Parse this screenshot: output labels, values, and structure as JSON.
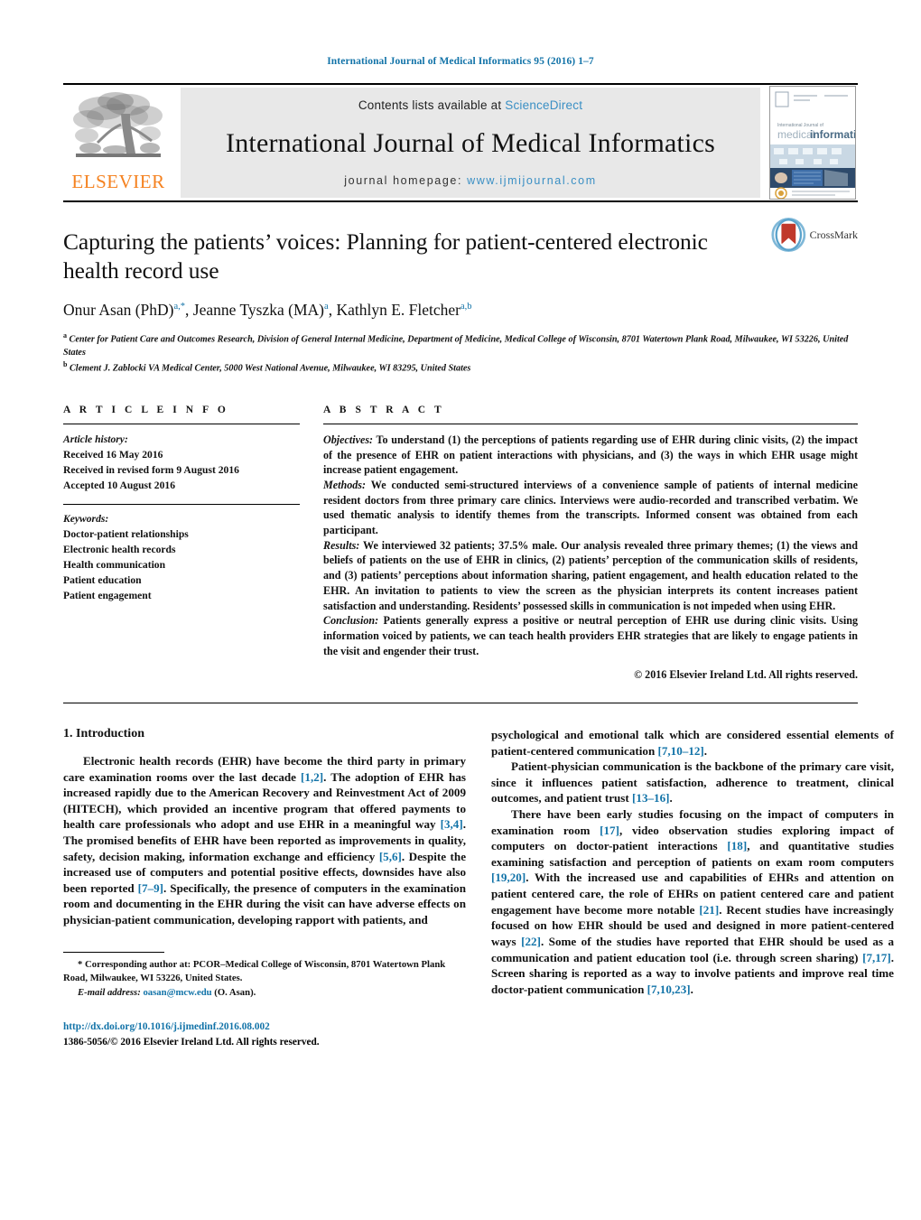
{
  "running_head": "International Journal of Medical Informatics 95 (2016) 1–7",
  "masthead": {
    "publisher_name": "ELSEVIER",
    "contents_prefix": "Contents lists available at",
    "sciencedirect": "ScienceDirect",
    "journal_title": "International Journal of Medical Informatics",
    "homepage_prefix": "journal homepage:",
    "homepage_url": "www.ijmijournal.com",
    "cover_title_1": "medical",
    "cover_title_2": "informatics",
    "link_color": "#3a8fc4",
    "elsevier_orange": "#f58220"
  },
  "article": {
    "title": "Capturing the patients’ voices: Planning for patient-centered electronic health record use",
    "crossmark_label": "CrossMark",
    "authors_html": "Onur Asan (PhD)<sup>a,</sup><sup>*</sup>, Jeanne Tyszka (MA)<sup>a</sup>, Kathlyn E. Fletcher<sup>a,b</sup>",
    "affiliation_a": "Center for Patient Care and Outcomes Research, Division of General Internal Medicine, Department of Medicine, Medical College of Wisconsin, 8701 Watertown Plank Road, Milwaukee, WI 53226, United States",
    "affiliation_b": "Clement J. Zablocki VA Medical Center, 5000 West National Avenue, Milwaukee, WI 83295, United States",
    "affiliation_a_marker": "a",
    "affiliation_b_marker": "b"
  },
  "article_info": {
    "heading": "A R T I C L E   I N F O",
    "history_label": "Article history:",
    "history": [
      "Received 16 May 2016",
      "Received in revised form 9 August 2016",
      "Accepted 10 August 2016"
    ],
    "keywords_label": "Keywords:",
    "keywords": [
      "Doctor-patient relationships",
      "Electronic health records",
      "Health communication",
      "Patient education",
      "Patient engagement"
    ]
  },
  "abstract": {
    "heading": "A B S T R A C T",
    "objectives_label": "Objectives:",
    "objectives_text": " To understand (1) the perceptions of patients regarding use of EHR during clinic visits, (2) the impact of the presence of EHR on patient interactions with physicians, and (3) the ways in which EHR usage might increase patient engagement.",
    "methods_label": "Methods:",
    "methods_text": " We conducted semi-structured interviews of a convenience sample of patients of internal medicine resident doctors from three primary care clinics. Interviews were audio-recorded and transcribed verbatim. We used thematic analysis to identify themes from the transcripts. Informed consent was obtained from each participant.",
    "results_label": "Results:",
    "results_text": " We interviewed 32 patients; 37.5% male. Our analysis revealed three primary themes; (1) the views and beliefs of patients on the use of EHR in clinics, (2) patients’ perception of the communication skills of residents, and (3) patients’ perceptions about information sharing, patient engagement, and health education related to the EHR. An invitation to patients to view the screen as the physician interprets its content increases patient satisfaction and understanding. Residents’ possessed skills in communication is not impeded when using EHR.",
    "conclusion_label": "Conclusion:",
    "conclusion_text": " Patients generally express a positive or neutral perception of EHR use during clinic visits. Using information voiced by patients, we can teach health providers EHR strategies that are likely to engage patients in the visit and engender their trust.",
    "copyright": "© 2016 Elsevier Ireland Ltd. All rights reserved."
  },
  "introduction": {
    "heading": "1. Introduction",
    "left_paragraph_1_parts": [
      {
        "t": "Electronic health records (EHR) have become the third party in primary care examination rooms over the last decade "
      },
      {
        "t": "[1,2]",
        "ref": true
      },
      {
        "t": ". The adoption of EHR has increased rapidly due to the American Recovery and Reinvestment Act of 2009 (HITECH), which provided an incentive program that offered payments to health care professionals who adopt and use EHR in a meaningful way "
      },
      {
        "t": "[3,4]",
        "ref": true
      },
      {
        "t": ". The promised benefits of EHR have been reported as improvements in quality, safety, decision making, information exchange and efficiency "
      },
      {
        "t": "[5,6]",
        "ref": true
      },
      {
        "t": ". Despite the increased use of computers and potential positive effects, downsides have also been reported "
      },
      {
        "t": "[7–9]",
        "ref": true
      },
      {
        "t": ". Specifically, the presence of computers in the examination room and documenting in the EHR during the visit can have adverse effects on physician-patient communication, developing rapport with patients, and"
      }
    ],
    "right_paragraph_1_parts": [
      {
        "t": "psychological and emotional talk which are considered essential elements of patient-centered communication "
      },
      {
        "t": "[7,10–12]",
        "ref": true
      },
      {
        "t": "."
      }
    ],
    "right_paragraph_2_parts": [
      {
        "t": "Patient-physician communication is the backbone of the primary care visit, since it influences patient satisfaction, adherence to treatment, clinical outcomes, and patient trust "
      },
      {
        "t": "[13–16]",
        "ref": true
      },
      {
        "t": "."
      }
    ],
    "right_paragraph_3_parts": [
      {
        "t": "There have been early studies focusing on the impact of computers in examination room "
      },
      {
        "t": "[17]",
        "ref": true
      },
      {
        "t": ", video observation studies exploring impact of computers on doctor-patient interactions "
      },
      {
        "t": "[18]",
        "ref": true
      },
      {
        "t": ", and quantitative studies examining satisfaction and perception of patients on exam room computers "
      },
      {
        "t": "[19,20]",
        "ref": true
      },
      {
        "t": ". With the increased use and capabilities of EHRs and attention on patient centered care, the role of EHRs on patient centered care and patient engagement have become more notable "
      },
      {
        "t": "[21]",
        "ref": true
      },
      {
        "t": ". Recent studies have increasingly focused on how EHR should be used and designed in more patient-centered ways "
      },
      {
        "t": "[22]",
        "ref": true
      },
      {
        "t": ". Some of the studies have reported that EHR should be used as a communication and patient education tool (i.e. through screen sharing) "
      },
      {
        "t": "[7,17]",
        "ref": true
      },
      {
        "t": ". Screen sharing is reported as a way to involve patients and improve real time doctor-patient communication "
      },
      {
        "t": "[7,10,23]",
        "ref": true
      },
      {
        "t": "."
      }
    ]
  },
  "footer": {
    "corresponding_marker": "*",
    "corresponding_text": " Corresponding author at: PCOR–Medical College of Wisconsin, 8701 Watertown Plank Road, Milwaukee, WI 53226, United States.",
    "email_label": "E-mail address:",
    "email": "oasan@mcw.edu",
    "email_suffix": " (O. Asan).",
    "doi": "http://dx.doi.org/10.1016/j.ijmedinf.2016.08.002",
    "issn_line": "1386-5056/© 2016 Elsevier Ireland Ltd. All rights reserved."
  }
}
